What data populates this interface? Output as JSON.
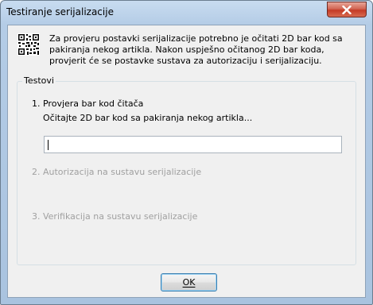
{
  "window": {
    "title": "Testiranje serijalizacije"
  },
  "intro": {
    "text": "Za provjeru postavki serijalizacije potrebno je očitati 2D bar kod sa pakiranja nekog artikla. Nakon uspješno očitanog 2D bar koda, provjerit će se postavke sustava za autorizaciju i serijalizaciju."
  },
  "tests": {
    "legend": "Testovi",
    "step1": {
      "label": "1. Provjera bar kod čitača",
      "instruction": "Očitajte 2D bar kod sa pakiranja nekog artikla...",
      "input_value": ""
    },
    "step2": {
      "label": "2. Autorizacija na sustavu serijalizacije"
    },
    "step3": {
      "label": "3. Verifikacija na sustavu serijalizacije"
    }
  },
  "buttons": {
    "ok_label": "OK"
  },
  "icons": {
    "close": "close-icon",
    "qr": "qr-code-icon"
  },
  "colors": {
    "disabled_text": "#a0a0a0",
    "close_button": "#c43b26",
    "frame": "#b4cce6"
  }
}
